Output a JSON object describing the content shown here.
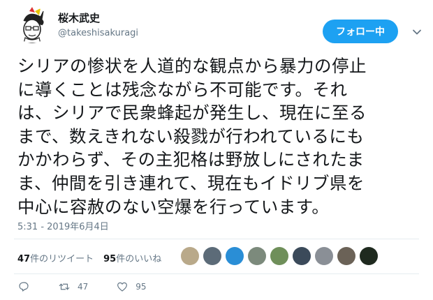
{
  "profile": {
    "display_name": "桜木武史",
    "handle": "@takeshisakuragi"
  },
  "follow_button": {
    "label": "フォロー中"
  },
  "tweet": {
    "lines": [
      "シリアの惨状を人道的な観点から暴力の停止",
      "に導くことは残念ながら不可能です。それ",
      "は、シリアで民衆蜂起が発生し、現在に至る",
      "まで、数えきれない殺戮が行われているにも",
      "かかわらず、その主犯格は野放しにされたま",
      "ま、仲間を引き連れて、現在もイドリブ県を",
      "中心に容赦のない空爆を行っています。"
    ],
    "timestamp": "5:31 - 2019年6月4日"
  },
  "stats": {
    "retweets_count": "47",
    "retweets_label": "件のリツイート",
    "likes_count": "95",
    "likes_label": "件のいいね"
  },
  "likers": [
    {
      "color": "#b9a98a"
    },
    {
      "color": "#5c6b78"
    },
    {
      "color": "#2a8ed6"
    },
    {
      "color": "#7c8a7c"
    },
    {
      "color": "#6f8f5a"
    },
    {
      "color": "#3b4a5a"
    },
    {
      "color": "#8a8f96"
    },
    {
      "color": "#6b6257"
    },
    {
      "color": "#1f2a1f"
    }
  ],
  "actions": {
    "reply_icon": "reply-icon",
    "retweet_icon": "retweet-icon",
    "retweet_count": "47",
    "like_icon": "heart-icon",
    "like_count": "95"
  },
  "colors": {
    "accent": "#1da1f2",
    "secondary_text": "#657786",
    "primary_text": "#14171a"
  }
}
